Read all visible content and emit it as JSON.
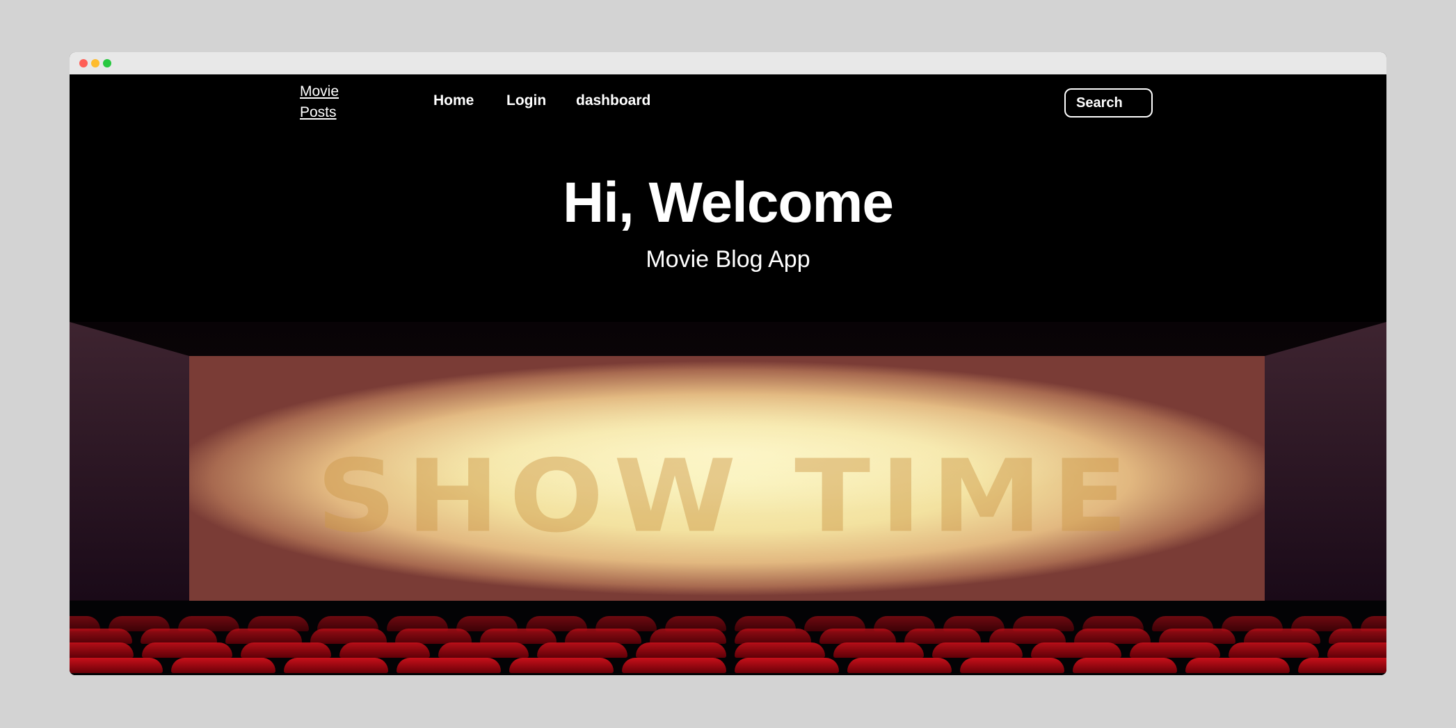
{
  "window": {
    "dots": [
      "#ff5f57",
      "#febc2e",
      "#28c840"
    ]
  },
  "nav": {
    "brand_line1": "Movie",
    "brand_line2": "Posts",
    "links": [
      "Home",
      "Login",
      "dashboard"
    ],
    "search_label": "Search"
  },
  "hero": {
    "title": "Hi, Welcome",
    "subtitle": "Movie Blog App",
    "screen_text": "SHOW TIME"
  }
}
